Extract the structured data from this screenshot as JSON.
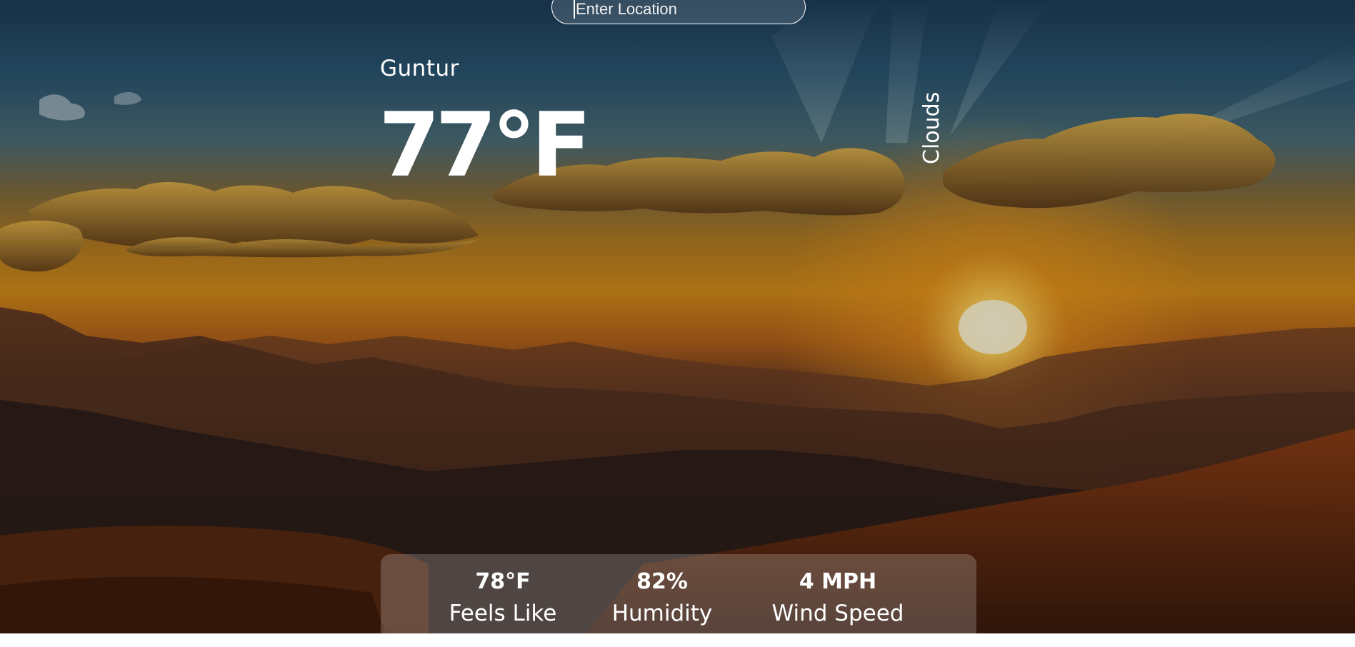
{
  "search": {
    "placeholder": "Enter Location"
  },
  "weather": {
    "location": "Guntur",
    "temperature": "77°F",
    "condition": "Clouds"
  },
  "stats": [
    {
      "value": "78°F",
      "label": "Feels Like"
    },
    {
      "value": "82%",
      "label": "Humidity"
    },
    {
      "value": "4 MPH",
      "label": "Wind Speed"
    }
  ],
  "colors": {
    "text": "#ffffff",
    "panel": "rgba(255,255,255,0.2)",
    "sky_top": "#1c3c58",
    "horizon": "#d28a1a",
    "ground": "#23160f"
  },
  "icons": {
    "background": "sunset-mountains-image"
  }
}
